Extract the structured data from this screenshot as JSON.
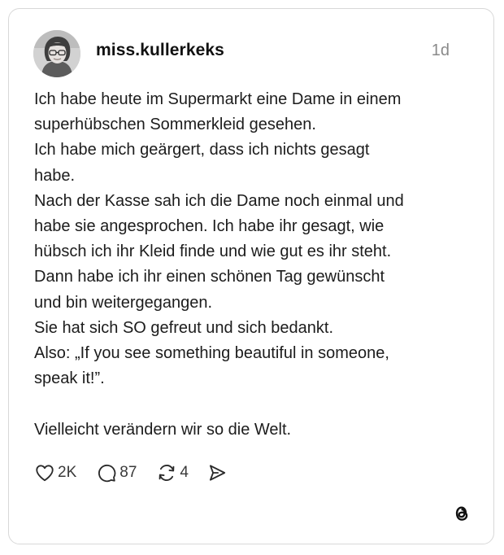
{
  "post": {
    "username": "miss.kullerkeks",
    "timestamp": "1d",
    "body_lines": [
      "Ich habe heute im Supermarkt eine Dame in einem",
      "superhübschen Sommerkleid gesehen.",
      "Ich habe mich geärgert, dass ich nichts gesagt",
      "habe.",
      "Nach der Kasse sah ich die Dame noch einmal und",
      "habe sie angesprochen. Ich habe ihr gesagt, wie",
      "hübsch ich ihr Kleid finde und wie gut es ihr steht.",
      "Dann habe ich ihr einen schönen Tag gewünscht",
      "und bin weitergegangen.",
      "Sie hat sich SO gefreut und sich bedankt.",
      "Also: „If you see something beautiful in someone,",
      "speak it!”.",
      "",
      "Vielleicht verändern wir so die Welt."
    ]
  },
  "actions": {
    "likes": "2K",
    "replies": "87",
    "reposts": "4"
  },
  "icons": {
    "like": "heart-icon",
    "reply": "speech-bubble-icon",
    "repost": "repost-icon",
    "share": "send-icon",
    "brand": "threads-logo"
  },
  "colors": {
    "text": "#1c1c1c",
    "muted": "#8a8a8a",
    "border": "#d8d8d8"
  }
}
